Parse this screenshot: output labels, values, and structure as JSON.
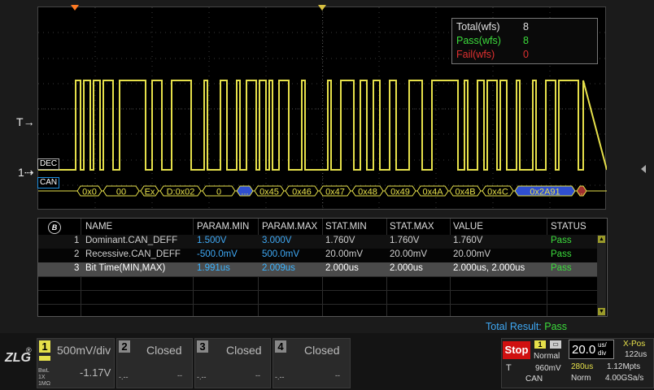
{
  "left_labels": {
    "trigger": "T",
    "channel": "1",
    "dec": "DEC",
    "can": "CAN"
  },
  "stats": {
    "total_label": "Total(wfs)",
    "total_value": "8",
    "pass_label": "Pass(wfs)",
    "pass_value": "8",
    "fail_label": "Fail(wfs)",
    "fail_value": "0"
  },
  "decode": {
    "frames": [
      "0x0",
      "00",
      "Ex",
      "D:0x02",
      "0",
      "...",
      "0x45",
      "0x46",
      "0x47",
      "0x48",
      "0x49",
      "0x4A",
      "0x4B",
      "0x4C",
      "0x2A91",
      "..."
    ]
  },
  "table": {
    "headers": [
      "NAME",
      "PARAM.MIN",
      "PARAM.MAX",
      "STAT.MIN",
      "STAT.MAX",
      "VALUE",
      "STATUS"
    ],
    "rows": [
      {
        "idx": "1",
        "name": "Dominant.CAN_DEFF",
        "pmin": "1.500V",
        "pmax": "3.000V",
        "smin": "1.760V",
        "smax": "1.760V",
        "value": "1.760V",
        "status": "Pass"
      },
      {
        "idx": "2",
        "name": "Recessive.CAN_DEFF",
        "pmin": "-500.0mV",
        "pmax": "500.0mV",
        "smin": "20.00mV",
        "smax": "20.00mV",
        "value": "20.00mV",
        "status": "Pass"
      },
      {
        "idx": "3",
        "name": "Bit Time(MIN,MAX)",
        "pmin": "1.991us",
        "pmax": "2.009us",
        "smin": "2.000us",
        "smax": "2.000us",
        "value": "2.000us, 2.000us",
        "status": "Pass"
      }
    ]
  },
  "total_result": {
    "label": "Total Result:",
    "value": "Pass"
  },
  "channels": [
    {
      "num": "1",
      "scale": "500mV/div",
      "offset": "-1.17V",
      "info1": "BwL",
      "info2": "1X",
      "info3": "1MΩ"
    },
    {
      "num": "2",
      "state": "Closed",
      "a": "-.--",
      "b": "--"
    },
    {
      "num": "3",
      "state": "Closed",
      "a": "-.--",
      "b": "--"
    },
    {
      "num": "4",
      "state": "Closed",
      "a": "-.--",
      "b": "--"
    }
  ],
  "acq": {
    "stop": "Stop",
    "trig_src": "1",
    "trig_mode": "Normal",
    "trig_type": "T",
    "trig_level": "960mV",
    "trig_proto": "CAN",
    "timebase": "20.0",
    "timebase_unit_top": "us/",
    "timebase_unit_bot": "div",
    "delay": "280us",
    "mem": "1.12Mpts",
    "acq_mode": "Norm",
    "rate": "4.00GSa/s",
    "xpos_label": "X-Pos",
    "xpos_value": "122us"
  },
  "colors": {
    "ch1": "#e6e04a",
    "decode": "#e6e04a",
    "can_frame": "#2f4fd0",
    "pass": "#3cdc3c",
    "fail": "#e03030",
    "accent": "#3fa9f5"
  }
}
